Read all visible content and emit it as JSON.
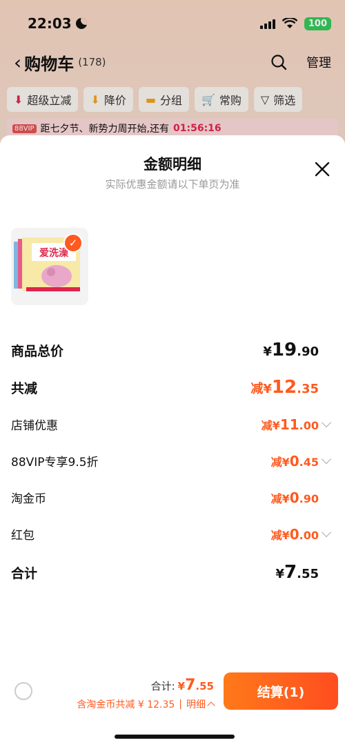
{
  "status_bar": {
    "time": "22:03",
    "battery": "100"
  },
  "nav": {
    "title": "购物车",
    "count": "(178)",
    "manage": "管理"
  },
  "filters": [
    {
      "icon": "arrow-down-red-icon",
      "label": "超级立减"
    },
    {
      "icon": "arrow-down-orange-icon",
      "label": "降价"
    },
    {
      "icon": "folder-icon",
      "label": "分组"
    },
    {
      "icon": "cart-icon",
      "label": "常购"
    },
    {
      "icon": "filter-icon",
      "label": "筛选"
    }
  ],
  "banner": {
    "tag": "88VIP",
    "text": "距七夕节、新势力周开始,还有",
    "countdown": "01:56:16"
  },
  "sheet": {
    "title": "金额明细",
    "subtitle": "实际优惠金额请以下单页为准",
    "product_image_text": "爱洗澡",
    "rows": [
      {
        "label": "商品总价",
        "prefix": "¥",
        "int": "19",
        "dec": ".90"
      },
      {
        "label": "共减",
        "prefix": "减¥",
        "int": "12",
        "dec": ".35"
      },
      {
        "label": "店铺优惠",
        "prefix": "减¥",
        "int": "11",
        "dec": ".00"
      },
      {
        "label": "88VIP专享9.5折",
        "prefix": "减¥",
        "int": "0",
        "dec": ".45"
      },
      {
        "label": "淘金币",
        "prefix": "减¥",
        "int": "0",
        "dec": ".90"
      },
      {
        "label": "红包",
        "prefix": "减¥",
        "int": "0",
        "dec": ".00"
      },
      {
        "label": "合计",
        "prefix": "¥",
        "int": "7",
        "dec": ".55"
      }
    ]
  },
  "bottom_bar": {
    "total_label": "合计:",
    "total_prefix": "¥",
    "total_int": "7",
    "total_dec": ".55",
    "saving_text": "含淘金币共减 ¥ 12.35",
    "separator": "|",
    "detail_label": "明细",
    "checkout_label": "结算(1)"
  },
  "colors": {
    "accent": "#ff5a1f",
    "countdown": "#e0244a",
    "battery": "#34c759"
  }
}
